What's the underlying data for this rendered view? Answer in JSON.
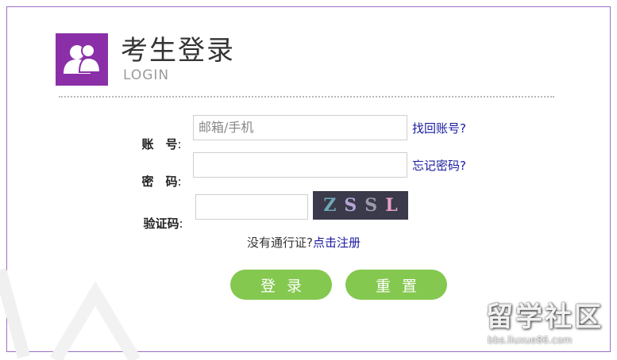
{
  "header": {
    "title": "考生登录",
    "subtitle": "LOGIN",
    "logo_icon": "users-icon"
  },
  "form": {
    "account": {
      "label": "账　号",
      "colon": ":",
      "placeholder": "邮箱/手机",
      "value": "",
      "link": "找回账号?"
    },
    "password": {
      "label": "密　码",
      "colon": ":",
      "value": "",
      "link": "忘记密码?"
    },
    "captcha": {
      "label": "验证码",
      "colon": ":",
      "value": "",
      "image_chars": [
        "Z",
        "S",
        "S",
        "L"
      ],
      "image_colors": [
        "#6fa8b8",
        "#b7a4d8",
        "#9a9aa8",
        "#e8a0c8"
      ]
    },
    "register": {
      "text": "没有通行证?",
      "link": "点击注册"
    },
    "buttons": {
      "login": "登录",
      "reset": "重置"
    }
  },
  "watermark": {
    "main": "留学社区",
    "url": "bbs.liuxue86.com"
  },
  "colors": {
    "brand_purple": "#8b2fa8",
    "frame_border": "#9b6fc8",
    "button_green": "#84c84f",
    "link_blue": "#1a1aa0"
  }
}
